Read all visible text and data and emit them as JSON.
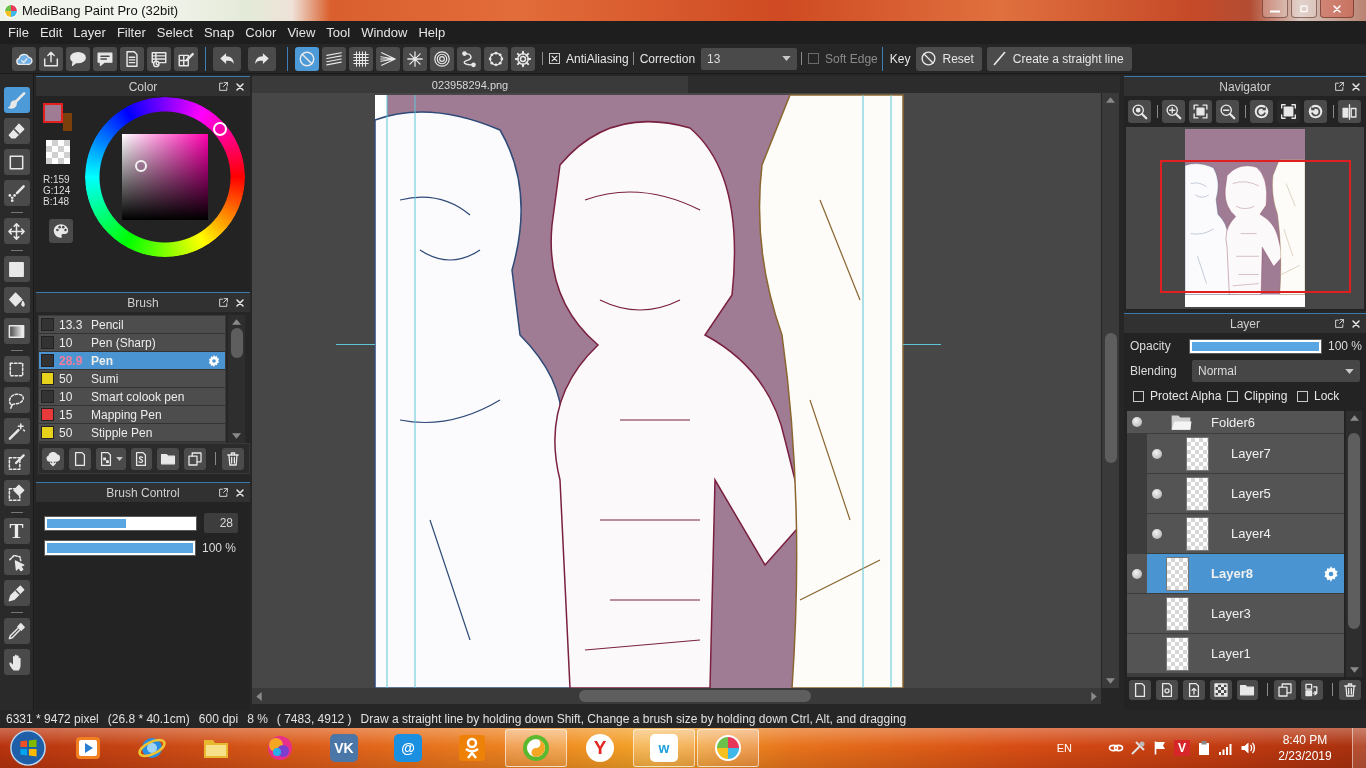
{
  "window": {
    "title": "MediBang Paint Pro (32bit)"
  },
  "menu": [
    "File",
    "Edit",
    "Layer",
    "Filter",
    "Select",
    "Snap",
    "Color",
    "View",
    "Tool",
    "Window",
    "Help"
  ],
  "toolbar": {
    "snap_modes": [
      {
        "selected": true
      },
      {
        "selected": false
      },
      {
        "selected": false
      },
      {
        "selected": false
      },
      {
        "selected": false
      },
      {
        "selected": false
      },
      {
        "selected": false
      },
      {
        "selected": false
      }
    ],
    "antialiasing": {
      "label": "AntiAliasing",
      "checked": true
    },
    "correction": {
      "label": "Correction",
      "value": "13"
    },
    "soft_edge": {
      "label": "Soft Edge",
      "checked": false,
      "disabled": true
    },
    "key_label": "Key",
    "reset_button": "Reset",
    "straight_line_button": "Create a straight line"
  },
  "tools": [
    {
      "selected": true
    },
    {
      "selected": false
    },
    {
      "selected": false
    },
    {
      "selected": false
    },
    {
      "selected": false
    },
    {
      "selected": false
    },
    {
      "selected": false
    },
    {
      "selected": false
    },
    {
      "selected": false
    },
    {
      "selected": false
    },
    {
      "selected": false
    },
    {
      "selected": false
    },
    {
      "selected": false
    },
    {
      "selected": false,
      "glyph": "T"
    },
    {
      "selected": false
    },
    {
      "selected": false
    },
    {
      "selected": false
    },
    {
      "selected": false
    }
  ],
  "color_panel": {
    "title": "Color",
    "swatches": [
      {
        "kind": "primary",
        "color": "#9f7c94"
      },
      {
        "kind": "secondary",
        "color": "#7b3f0c"
      },
      {
        "kind": "transparent"
      }
    ],
    "readout": [
      "R:159",
      "G:124",
      "B:148"
    ]
  },
  "brush_panel": {
    "title": "Brush",
    "brushes": [
      {
        "size": "13.3",
        "name": "Pencil",
        "color": "#333333",
        "selected": false
      },
      {
        "size": "10",
        "name": "Pen (Sharp)",
        "color": "#333333",
        "selected": false
      },
      {
        "size": "28.9",
        "name": "Pen",
        "color": "#333333",
        "selected": true
      },
      {
        "size": "50",
        "name": "Sumi",
        "color": "#e6d21c",
        "selected": false
      },
      {
        "size": "10",
        "name": "Smart colook pen",
        "color": "#333333",
        "selected": false
      },
      {
        "size": "15",
        "name": "Mapping Pen",
        "color": "#e83a3a",
        "selected": false
      },
      {
        "size": "50",
        "name": "Stipple Pen",
        "color": "#e6d21c",
        "selected": false
      }
    ]
  },
  "brush_control": {
    "title": "Brush Control",
    "size": {
      "level": 0.54,
      "value": "28"
    },
    "opacity": {
      "level": 1,
      "value": "100 %"
    }
  },
  "document": {
    "tab": "023958294.png"
  },
  "navigator": {
    "title": "Navigator"
  },
  "layer_panel": {
    "title": "Layer",
    "opacity": {
      "label": "Opacity",
      "level": 1,
      "value": "100 %"
    },
    "blending": {
      "label": "Blending",
      "value": "Normal"
    },
    "options": [
      {
        "label": "Protect Alpha",
        "checked": false
      },
      {
        "label": "Clipping",
        "checked": false
      },
      {
        "label": "Lock",
        "checked": false
      }
    ],
    "layers": [
      {
        "kind": "folder",
        "name": "Folder6",
        "visible": true,
        "selected": false,
        "expanded": true,
        "children": [
          {
            "kind": "layer",
            "name": "Layer7",
            "visible": true,
            "selected": false
          },
          {
            "kind": "layer",
            "name": "Layer5",
            "visible": true,
            "selected": false
          },
          {
            "kind": "layer",
            "name": "Layer4",
            "visible": true,
            "selected": false
          }
        ]
      },
      {
        "kind": "layer",
        "name": "Layer8",
        "visible": true,
        "selected": true
      },
      {
        "kind": "layer",
        "name": "Layer3",
        "visible": false,
        "selected": false
      },
      {
        "kind": "layer",
        "name": "Layer1",
        "visible": false,
        "selected": false
      }
    ]
  },
  "status_bar": [
    "6331 * 9472 pixel",
    "(26.8 * 40.1cm)",
    "600 dpi",
    "8 %",
    "( 7483, 4912 )",
    "Draw a straight line by holding down Shift, Change a brush size by holding down Ctrl, Alt, and dragging"
  ],
  "taskbar": {
    "apps": [
      {
        "kind": "player",
        "running": false
      },
      {
        "kind": "browser",
        "running": false
      },
      {
        "kind": "folder",
        "running": false
      },
      {
        "kind": "ball",
        "running": false
      },
      {
        "kind": "tile",
        "glyph": "VK",
        "color": "#4a76a8",
        "running": false
      },
      {
        "kind": "tile",
        "glyph": "@",
        "color": "#1b8fe0",
        "running": false
      },
      {
        "kind": "person",
        "color": "#ee8208",
        "running": false
      },
      {
        "kind": "swirl",
        "running": true
      },
      {
        "kind": "disc",
        "glyph": "Y",
        "color": "#ffffff",
        "running": false
      },
      {
        "kind": "tile",
        "glyph": "w",
        "color": "#ffffff",
        "running": true
      },
      {
        "kind": "pinwheel",
        "running": true
      }
    ],
    "language": "EN",
    "tray_badge": "V",
    "time": "8:40 PM",
    "date": "2/23/2019"
  }
}
